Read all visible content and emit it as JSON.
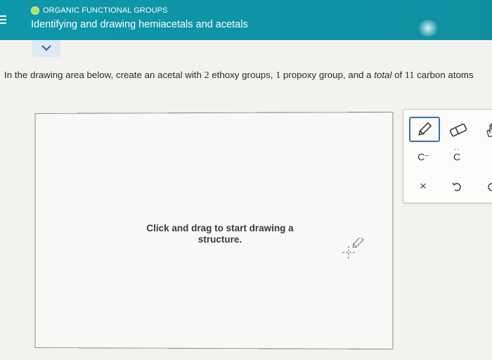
{
  "header": {
    "section_label": "ORGANIC FUNCTIONAL GROUPS",
    "lesson_title": "Identifying and drawing hemiacetals and acetals"
  },
  "instruction": {
    "part1": "In the drawing area below, create an acetal with ",
    "n_ethoxy": "2",
    "part2": " ethoxy groups, ",
    "n_propoxy": "1",
    "part3": " propoxy group, and a ",
    "emph": "total",
    "part4": " of ",
    "n_carbon": "11",
    "part5": " carbon atoms"
  },
  "canvas": {
    "hint": "Click and drag to start drawing a structure."
  },
  "toolbar": {
    "tools": [
      {
        "name": "pencil-icon",
        "selected": true
      },
      {
        "name": "eraser-icon"
      },
      {
        "name": "hand-icon"
      },
      {
        "label": "C",
        "superscript": "–"
      },
      {
        "label": "C",
        "dots": "lone-pair"
      },
      {
        "name": "close-icon",
        "glyph": "×"
      },
      {
        "name": "undo-icon"
      },
      {
        "name": "redo-icon"
      }
    ]
  },
  "colors": {
    "header_bg": "#0f97aa",
    "status_dot": "#b6dc6a",
    "selected_tool_border": "#3d6ea6"
  }
}
